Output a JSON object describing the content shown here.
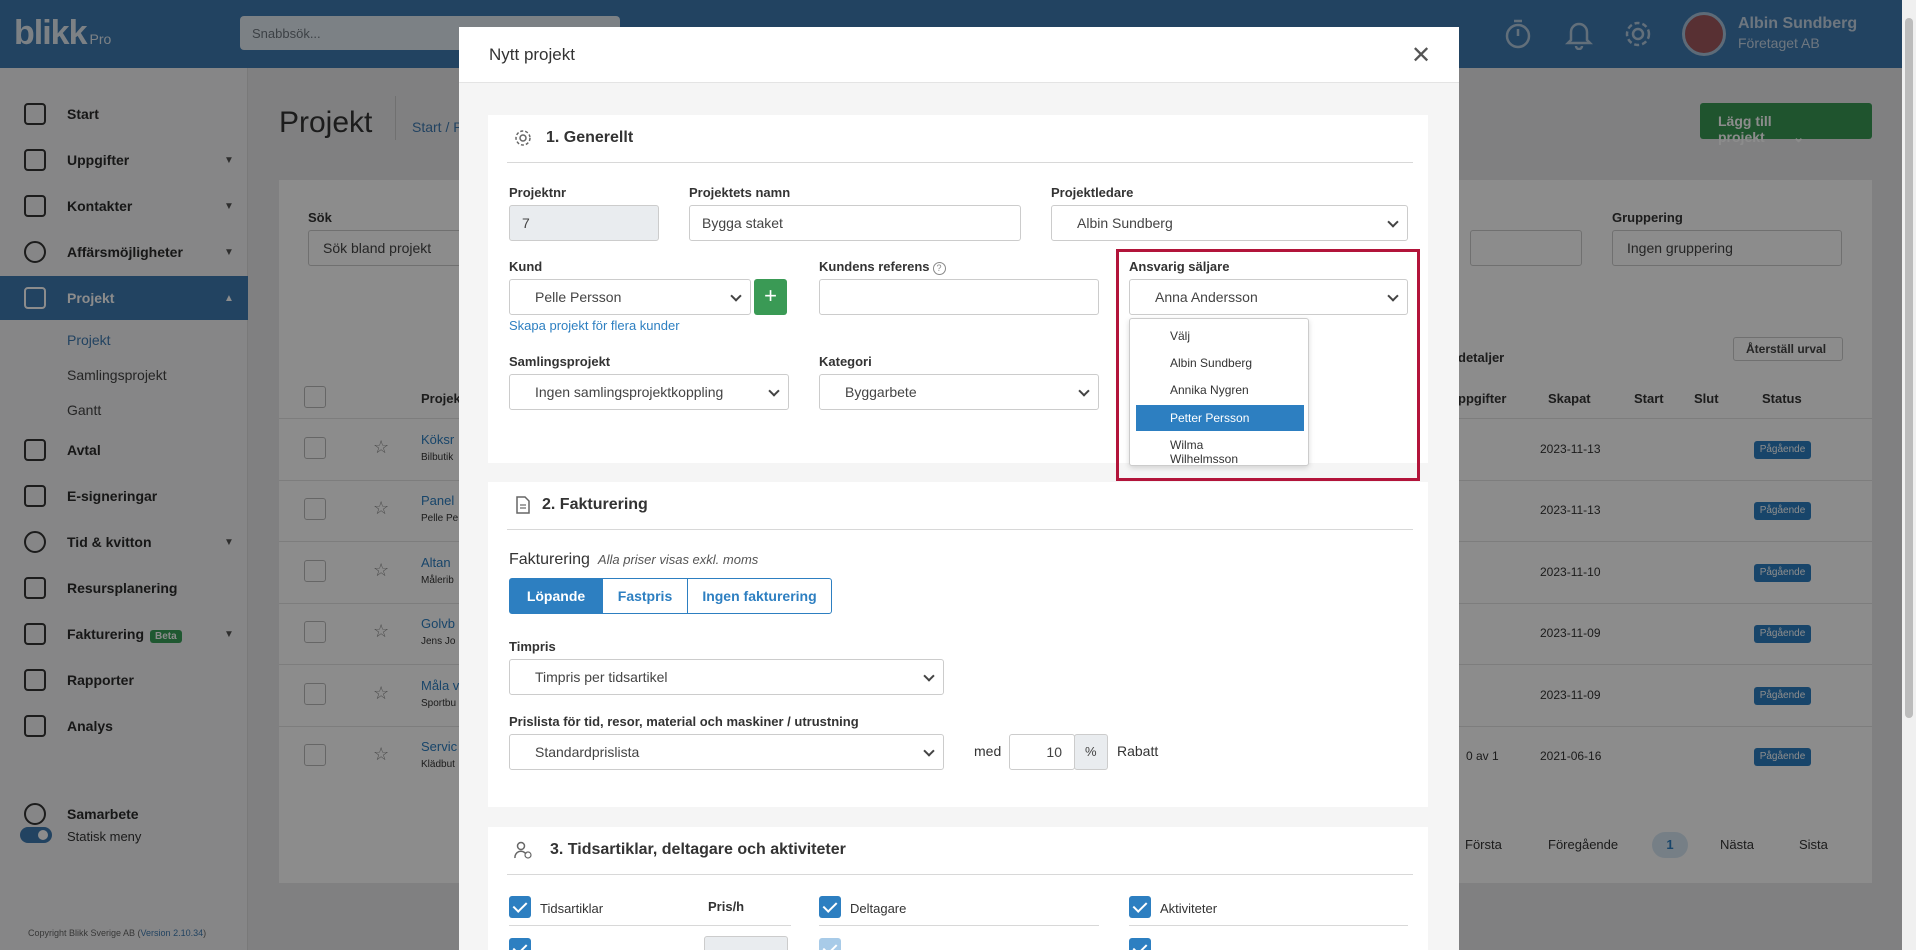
{
  "app": {
    "logo_text": "blikk",
    "logo_sub": "Pro",
    "search_placeholder": "Snabbsök...",
    "user_name": "Albin Sundberg",
    "user_company": "Företaget AB"
  },
  "sidebar": {
    "items": [
      {
        "label": "Start",
        "icon": "home-icon"
      },
      {
        "label": "Uppgifter",
        "icon": "checkbox-icon"
      },
      {
        "label": "Kontakter",
        "icon": "contacts-icon"
      },
      {
        "label": "Affärsmöjligheter",
        "icon": "dollar-icon"
      },
      {
        "label": "Projekt",
        "icon": "table-icon"
      },
      {
        "label": "Avtal",
        "icon": "contract-icon"
      },
      {
        "label": "E-signeringar",
        "icon": "signature-icon"
      },
      {
        "label": "Tid & kvitton",
        "icon": "clock-icon"
      },
      {
        "label": "Resursplanering",
        "icon": "calendar-icon"
      },
      {
        "label": "Fakturering",
        "icon": "invoice-icon",
        "badge": "Beta"
      },
      {
        "label": "Rapporter",
        "icon": "bar-chart-icon"
      },
      {
        "label": "Analys",
        "icon": "analytics-icon"
      },
      {
        "label": "Samarbete",
        "icon": "share-icon"
      }
    ],
    "sub_items": [
      "Projekt",
      "Samlingsprojekt",
      "Gantt"
    ],
    "toggle_label": "Statisk meny",
    "copyright": "Copyright Blikk Sverige AB (",
    "version": "Version 2.10.34",
    "copyright_end": ")"
  },
  "page": {
    "title": "Projekt",
    "breadcrumb": "Start / P",
    "add_button": "Lägg till projekt",
    "search_label": "Sök",
    "search_placeholder": "Sök bland projekt",
    "grouping_label": "Gruppering",
    "grouping_value": "Ingen gruppering",
    "details_label": "detaljer",
    "reset_button": "Återställ urval",
    "columns": {
      "project": "Projek",
      "tasks": "ppgifter",
      "created": "Skapat",
      "start": "Start",
      "end": "Slut",
      "status": "Status"
    },
    "rows": [
      {
        "name": "Köksr",
        "sub": "Bilbutik",
        "created": "2023-11-13",
        "status": "Pågående",
        "tasks": ""
      },
      {
        "name": "Panel",
        "sub": "Pelle Pe",
        "created": "2023-11-13",
        "status": "Pågående",
        "tasks": ""
      },
      {
        "name": "Altan",
        "sub": "Målerib",
        "created": "2023-11-10",
        "status": "Pågående",
        "tasks": ""
      },
      {
        "name": "Golvb",
        "sub": "Jens Jo",
        "created": "2023-11-09",
        "status": "Pågående",
        "tasks": ""
      },
      {
        "name": "Måla v",
        "sub": "Sportbu",
        "created": "2023-11-09",
        "status": "Pågående",
        "tasks": ""
      },
      {
        "name": "Servic",
        "sub": "Klädbut",
        "created": "2021-06-16",
        "status": "Pågående",
        "tasks": "0 av 1"
      }
    ],
    "pagination": {
      "first": "Första",
      "prev": "Föregående",
      "current": "1",
      "next": "Nästa",
      "last": "Sista"
    }
  },
  "modal": {
    "title": "Nytt projekt",
    "section1": {
      "title": "1. Generellt",
      "projektnr_label": "Projektnr",
      "projektnr_value": "7",
      "namn_label": "Projektets namn",
      "namn_value": "Bygga staket",
      "ledare_label": "Projektledare",
      "ledare_value": "Albin Sundberg",
      "kund_label": "Kund",
      "kund_value": "Pelle Persson",
      "kund_add": "+",
      "kund_link": "Skapa projekt för flera kunder",
      "referens_label": "Kundens referens",
      "referens_value": "",
      "saljare_label": "Ansvarig säljare",
      "saljare_value": "Anna Andersson",
      "saljare_options": [
        "Välj",
        "Albin Sundberg",
        "Annika Nygren",
        "Petter Persson",
        "Wilma Wilhelmsson"
      ],
      "saljare_highlighted": "Petter Persson",
      "samling_label": "Samlingsprojekt",
      "samling_value": "Ingen samlingsprojektkoppling",
      "kategori_label": "Kategori",
      "kategori_value": "Byggarbete"
    },
    "section2": {
      "title": "2. Fakturering",
      "heading": "Fakturering",
      "note": "Alla priser visas exkl. moms",
      "modes": [
        "Löpande",
        "Fastpris",
        "Ingen fakturering"
      ],
      "active_mode": "Löpande",
      "timpris_label": "Timpris",
      "timpris_value": "Timpris per tidsartikel",
      "prislista_label": "Prislista för tid, resor, material och maskiner / utrustning",
      "prislista_value": "Standardprislista",
      "med_label": "med",
      "rabatt_value": "10",
      "percent": "%",
      "rabatt_label": "Rabatt"
    },
    "section3": {
      "title": "3. Tidsartiklar, deltagare och aktiviteter",
      "col1": "Tidsartiklar",
      "col1_price": "Pris/h",
      "col2": "Deltagare",
      "col3": "Aktiviteter"
    }
  }
}
